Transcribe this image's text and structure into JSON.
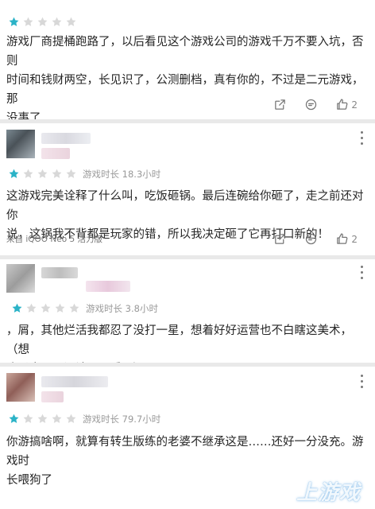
{
  "colors": {
    "star_on": "#2bb3c7",
    "star_off": "#d8d8d8",
    "background": "#e9e9e9"
  },
  "reviews": [
    {
      "rating": 1,
      "playtime": "",
      "text": "游戏厂商提桶跑路了，以后看见这个游戏公司的游戏千万不要入坑，否则\n时间和钱财两空，长见识了，公测删档，真有你的，不过是二元游戏，那\n没事了",
      "likes": "2",
      "device": ""
    },
    {
      "rating": 1,
      "playtime": "游戏时长 18.3小时",
      "text": "这游戏完美诠释了什么叫，吃饭砸锅。最后连碗给你砸了，走之前还对你\n说，这锅我不背都是玩家的错，所以我决定砸了它再打口新的！",
      "likes": "2",
      "device": "来自 iQOO Neo 5 活力版"
    },
    {
      "rating": 1,
      "playtime": "游戏时长 3.8小时",
      "text": "，屑，其他烂活我都忍了没打一星，想着好好运营也不白瞎这美术，（想\n吃瓜去公司评论里面看吧）",
      "likes": "",
      "device": ""
    },
    {
      "rating": 1,
      "playtime": "游戏时长 79.7小时",
      "text": "你游搞啥啊，就算有转生版练的老婆不继承这是……还好一分没充。游戏时\n长喂狗了\n\n感谢画师。",
      "likes": "",
      "device": ""
    }
  ],
  "icons": {
    "share": "share-icon",
    "comment": "comment-icon",
    "like": "thumbs-up-icon",
    "more": "more-vertical-icon",
    "star": "star-icon"
  }
}
